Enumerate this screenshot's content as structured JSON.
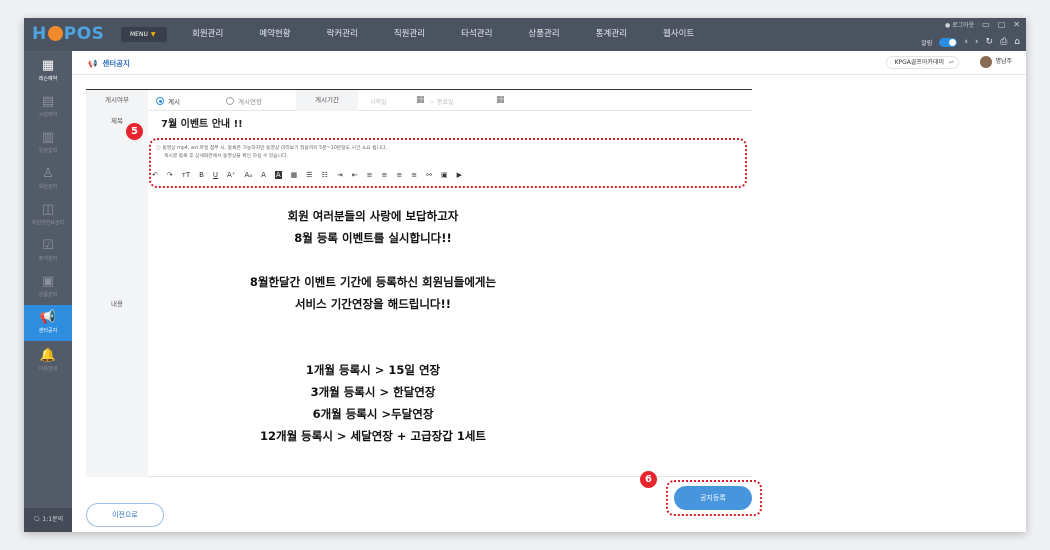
{
  "app": {
    "logo": "HOPOS",
    "menu_label": "MENU",
    "menu_caret": "▼"
  },
  "nav": [
    "회원관리",
    "예약현황",
    "락커관리",
    "직원관리",
    "타석관리",
    "상품관리",
    "통계관리",
    "웹사이트"
  ],
  "window": {
    "logout": "● 로그아웃",
    "alarm_label": "알림"
  },
  "sidebar": {
    "items": [
      {
        "label": "레슨예약",
        "icon": "calendar-icon"
      },
      {
        "label": "시설예약",
        "icon": "facility-icon"
      },
      {
        "label": "일정입력",
        "icon": "schedule-icon"
      },
      {
        "label": "회원관리",
        "icon": "user-icon"
      },
      {
        "label": "회원권만료관리",
        "icon": "membership-icon"
      },
      {
        "label": "출석관리",
        "icon": "attendance-icon"
      },
      {
        "label": "상품관리",
        "icon": "product-icon"
      },
      {
        "label": "센터공지",
        "icon": "megaphone-icon"
      },
      {
        "label": "이용안내",
        "icon": "bell-icon"
      }
    ],
    "bottom": "1:1문의"
  },
  "header": {
    "title": "센터공지",
    "club": "KPGA골프아카데미",
    "user": "명남주"
  },
  "form": {
    "post_label": "게시여부",
    "radio_post": "게시",
    "radio_limit": "게시연장",
    "period_label": "게시기간",
    "start_placeholder": "시작일",
    "end_placeholder": "~  종료일",
    "subject_label": "제목",
    "subject_value": "7월 이벤트 안내 !!",
    "content_label": "내용",
    "hint_line1": "ⓘ  동영상 mp4, avi 파일 첨부 시, 등록은 가능하지만 동영상 미리보기 적용까지 5분~10분정도 시간 소요 됩니다.",
    "hint_line2": "게시글 등록 후 상세화면에서 동영상을 확인 하실 수 있습니다.",
    "content_lines": [
      "회원 여러분들의 사랑에 보답하고자",
      "8월 등록 이벤트를 실시합니다!!",
      "",
      "8월한달간 이벤트 기간에 등록하신 회원님들에게는",
      "서비스 기간연장을 해드립니다!!",
      "",
      "",
      "1개월 등록시  > 15일 연장",
      "3개월 등록시 > 한달연장",
      "6개월 등록시 >두달연장",
      "12개월 등록시 > 세달연장 + 고급장갑 1세트"
    ]
  },
  "toolbar": [
    "↶",
    "↷",
    "ᴛT",
    "B",
    "U",
    "A⁺",
    "Aₐ",
    "A",
    "A",
    "▦",
    "☰",
    "☷",
    "⇥",
    "⇤",
    "≡",
    "≡",
    "≡",
    "≡",
    "⚯",
    "▣",
    "▶"
  ],
  "badges": {
    "editor_step": "5",
    "submit_step": "6"
  },
  "buttons": {
    "prev": "이전으로",
    "submit": "공지등록"
  },
  "colors": {
    "accent": "#2d8ee0",
    "highlight": "#d91d2a",
    "sidebar": "#545b68",
    "topbar": "#4b5361"
  }
}
